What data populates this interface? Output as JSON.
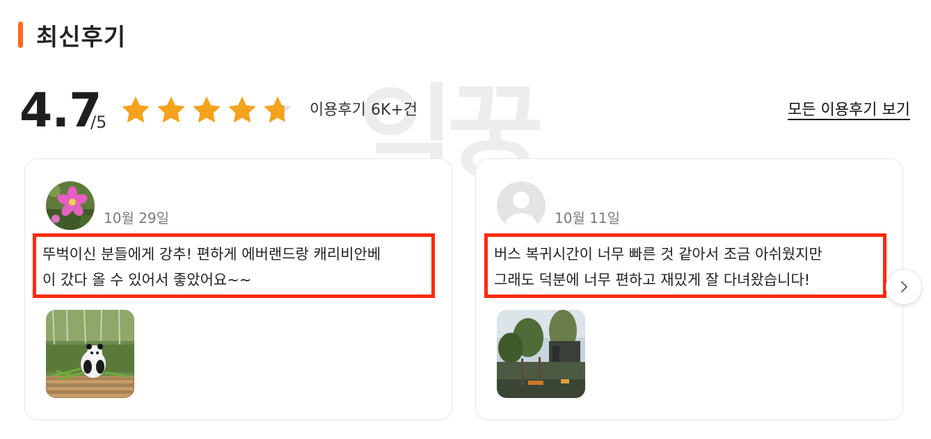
{
  "section": {
    "title": "최신후기"
  },
  "rating": {
    "score": "4.7",
    "max": "/5",
    "stars": 4.7,
    "review_count": "이용후기 6K+건",
    "all_reviews_link": "모든 이용후기 보기"
  },
  "watermark": {
    "text": "익꿍"
  },
  "colors": {
    "accent": "#ff6a1a",
    "star": "#f5a21d",
    "highlight_border": "#ff2a0c"
  },
  "reviews": [
    {
      "date": "10월 29일",
      "lines": [
        "뚜벅이신 분들에게 강추! 편하게 에버랜드랑 캐리비안베",
        "이 갔다 올 수 있어서 좋았어요~~"
      ],
      "avatar": "flower-photo",
      "photo": "panda-photo"
    },
    {
      "date": "10월 11일",
      "lines": [
        "버스 복귀시간이 너무 빠른 것 같아서 조금 아쉬웠지만",
        "그래도 덕분에 너무 편하고 재밌게 잘 다녀왔습니다!"
      ],
      "avatar": "default-user-icon",
      "photo": "zoo-photo"
    }
  ],
  "navigation": {
    "next_icon": "chevron-right-icon"
  }
}
